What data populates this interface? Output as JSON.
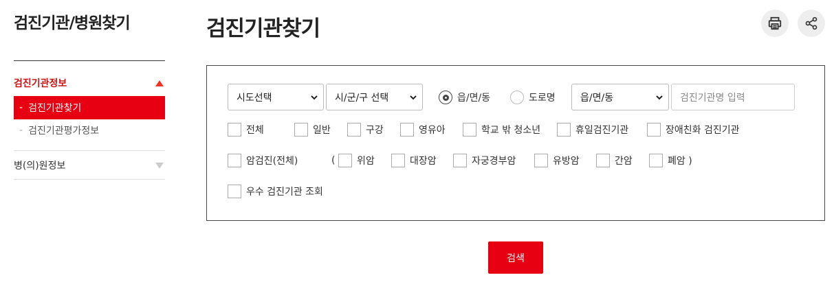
{
  "sidebar": {
    "title": "검진기관/병원찾기",
    "group1": {
      "label": "검진기관정보",
      "items": [
        {
          "label": "검진기관찾기"
        },
        {
          "label": "검진기관평가정보"
        }
      ]
    },
    "group2": {
      "label": "병(의)원정보"
    },
    "accent_color": "#e60012"
  },
  "main": {
    "title": "검진기관찾기",
    "print_icon": "printer-icon",
    "share_icon": "share-icon"
  },
  "search": {
    "sido_select": "시도선택",
    "sigungu_select": "시/군/구 선택",
    "radio_dong": "읍/면/동",
    "radio_road": "도로명",
    "dong_select": "읍/면/동",
    "name_placeholder": "검진기관명 입력",
    "row1": [
      "전체",
      "일반",
      "구강",
      "영유아",
      "학교 밖 청소년",
      "휴일검진기관",
      "장애친화 검진기관"
    ],
    "cancer_all": "암검진(전체)",
    "paren_open": "(",
    "cancers": [
      "위암",
      "대장암",
      "자궁경부암",
      "유방암",
      "간암",
      "폐암 )"
    ],
    "excellent": "우수 검진기관 조회",
    "button": "검색"
  }
}
